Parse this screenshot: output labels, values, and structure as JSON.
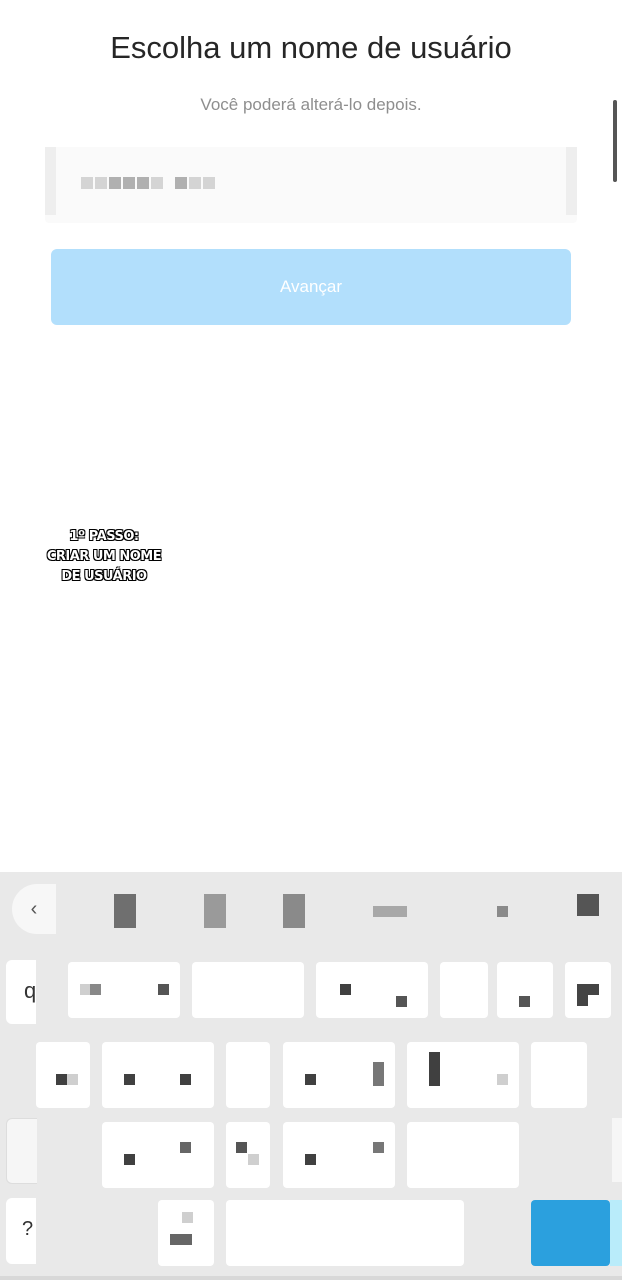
{
  "header": {
    "title": "Escolha um nome de usuário",
    "subtitle": "Você poderá alterá-lo depois."
  },
  "username_field": {
    "value": "",
    "obscured": true
  },
  "next_button": {
    "label": "Avançar",
    "enabled": false,
    "color": "#b2dffc"
  },
  "annotation": {
    "line1": "1º PASSO:",
    "line2": "CRIAR UM NOME",
    "line3": "DE USUÁRIO"
  },
  "keyboard": {
    "first_key": "q",
    "symbols_key": "?",
    "back_icon": "chevron-left-icon",
    "enter_color": "#2ba0de"
  }
}
